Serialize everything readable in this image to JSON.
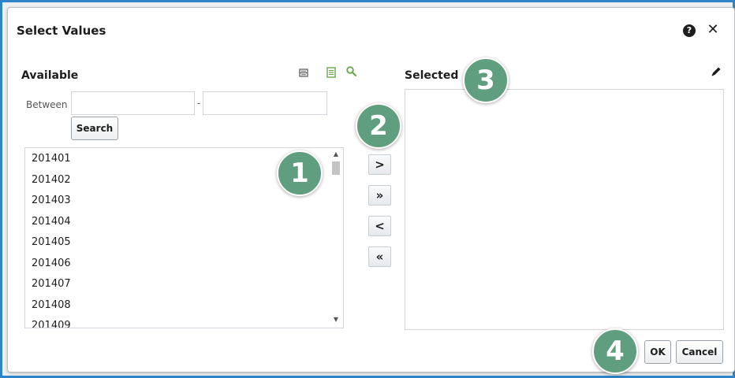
{
  "dialog": {
    "title": "Select Values",
    "help_icon": "?",
    "close_icon": "✕"
  },
  "available": {
    "label": "Available",
    "between_label": "Between",
    "range_separator": "-",
    "range_from": "",
    "range_to": "",
    "search_label": "Search",
    "items": [
      "201401",
      "201402",
      "201403",
      "201404",
      "201405",
      "201406",
      "201407",
      "201408",
      "201409"
    ]
  },
  "transfer": {
    "move_label": ">",
    "move_all_label": "»",
    "remove_label": "<",
    "remove_all_label": "«"
  },
  "selected": {
    "label": "Selected",
    "items": []
  },
  "footer": {
    "ok_label": "OK",
    "cancel_label": "Cancel"
  },
  "markers": [
    "1",
    "2",
    "3",
    "4"
  ],
  "colors": {
    "frame_border": "#2d84c8",
    "marker": "#5f9e7e",
    "icon_green": "#6aa84f"
  }
}
